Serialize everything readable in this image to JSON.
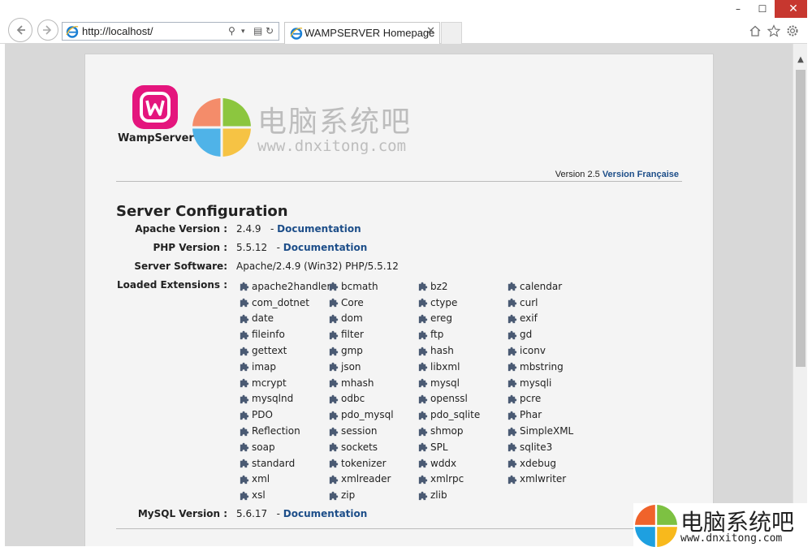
{
  "browser": {
    "url": "http://localhost/",
    "tab_title": "WAMPSERVER Homepage",
    "tab_close": "✕",
    "window_controls": [
      "–",
      "☐",
      "✕"
    ],
    "icons": [
      "back-arrow-icon",
      "forward-arrow-icon",
      "ie-icon",
      "search-icon",
      "dropdown-icon",
      "compat-view-icon",
      "refresh-icon",
      "home-icon",
      "favorites-star-icon",
      "settings-gear-icon"
    ]
  },
  "header": {
    "logo_name": "WampServer",
    "watermark_cn": "电脑系统吧",
    "watermark_en": "www.dnxitong.com",
    "version_text": "Version 2.5",
    "version_link": "Version Française"
  },
  "config": {
    "title": "Server Configuration",
    "apache_label": "Apache Version :",
    "apache_value": "2.4.9",
    "apache_sep": "-",
    "apache_doc": "Documentation",
    "php_label": "PHP Version :",
    "php_value": "5.5.12",
    "php_sep": "-",
    "php_doc": "Documentation",
    "software_label": "Server Software:",
    "software_value": "Apache/2.4.9 (Win32) PHP/5.5.12",
    "ext_label": "Loaded Extensions :",
    "extensions": [
      "apache2handler",
      "bcmath",
      "bz2",
      "calendar",
      "com_dotnet",
      "Core",
      "ctype",
      "curl",
      "date",
      "dom",
      "ereg",
      "exif",
      "fileinfo",
      "filter",
      "ftp",
      "gd",
      "gettext",
      "gmp",
      "hash",
      "iconv",
      "imap",
      "json",
      "libxml",
      "mbstring",
      "mcrypt",
      "mhash",
      "mysql",
      "mysqli",
      "mysqlnd",
      "odbc",
      "openssl",
      "pcre",
      "PDO",
      "pdo_mysql",
      "pdo_sqlite",
      "Phar",
      "Reflection",
      "session",
      "shmop",
      "SimpleXML",
      "soap",
      "sockets",
      "SPL",
      "sqlite3",
      "standard",
      "tokenizer",
      "wddx",
      "xdebug",
      "xml",
      "xmlreader",
      "xmlrpc",
      "xmlwriter",
      "xsl",
      "zip",
      "zlib"
    ],
    "mysql_label": "MySQL Version :",
    "mysql_value": "5.6.17",
    "mysql_sep": "-",
    "mysql_doc": "Documentation"
  },
  "colors": {
    "link": "#1d4e89",
    "wamp_pink": "#e4157d",
    "close_red": "#c7372f"
  }
}
